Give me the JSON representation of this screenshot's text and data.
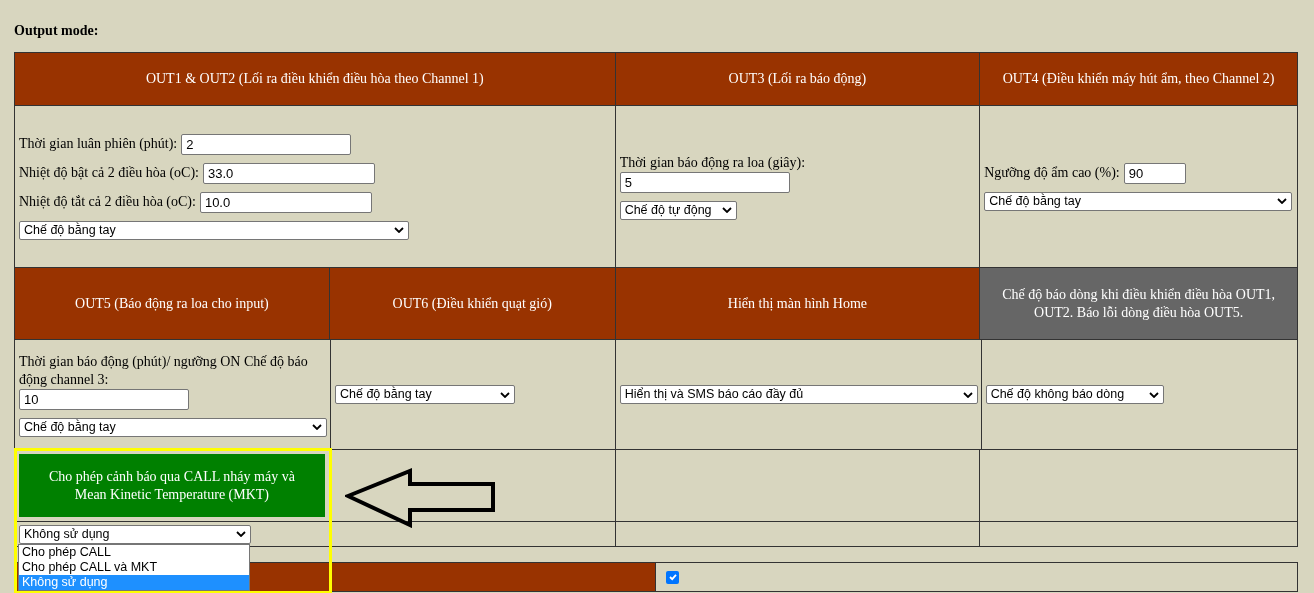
{
  "section_title": "Output mode:",
  "rows": [
    {
      "headers": [
        {
          "title": "OUT1 & OUT2 (Lối ra điều khiển điều hòa theo Channel 1)",
          "color": "#993300"
        },
        {
          "title": "OUT3 (Lối ra báo động)",
          "color": "#993300"
        },
        {
          "title": "OUT4 (Điều khiển máy hút ẩm, theo Channel 2)",
          "color": "#993300"
        }
      ],
      "cells": [
        {
          "controls": [
            {
              "kind": "input",
              "label": "Thời gian luân phiên (phút):",
              "value": "2"
            },
            {
              "kind": "input",
              "label": "Nhiệt độ bật cả 2 điều hòa (oC):",
              "value": "33.0"
            },
            {
              "kind": "input",
              "label": "Nhiệt độ tắt cả 2 điều hòa (oC):",
              "value": "10.0"
            },
            {
              "kind": "select",
              "value": "Chế độ bằng tay"
            }
          ]
        },
        {
          "controls": [
            {
              "kind": "input_below",
              "label": "Thời gian báo động ra loa (giây):",
              "value": "5"
            },
            {
              "kind": "select",
              "value": "Chế độ tự động"
            }
          ]
        },
        {
          "controls": [
            {
              "kind": "input",
              "label": "Ngưỡng độ ẩm cao (%):",
              "value": "90"
            },
            {
              "kind": "select",
              "value": "Chế độ bằng tay"
            }
          ]
        }
      ]
    },
    {
      "headers": [
        {
          "title": "OUT5 (Báo động ra loa cho input)",
          "color": "#993300"
        },
        {
          "title": "OUT6 (Điều khiển quạt gió)",
          "color": "#993300"
        },
        {
          "title": "Hiển thị màn hình Home",
          "color": "#993300"
        },
        {
          "title": "Chế độ báo dòng khi điều khiển điều hòa OUT1, OUT2. Báo lỗi dòng điều hòa OUT5.",
          "color": "#666666"
        }
      ],
      "cells": [
        {
          "controls": [
            {
              "kind": "input_below",
              "label": "Thời gian báo động (phút)/ ngưỡng ON Chế độ báo động channel 3:",
              "value": "10"
            },
            {
              "kind": "select",
              "value": "Chế độ bằng tay"
            }
          ]
        },
        {
          "controls": [
            {
              "kind": "select",
              "value": "Chế độ bằng tay"
            }
          ]
        },
        {
          "controls": [
            {
              "kind": "select",
              "value": "Hiển thị và SMS báo cáo đầy đủ"
            }
          ]
        },
        {
          "controls": [
            {
              "kind": "select",
              "value": "Chế độ không báo dòng"
            }
          ]
        }
      ]
    }
  ],
  "mkt": {
    "title": "Cho phép cảnh báo qua CALL nháy máy và Mean Kinetic Temperature (MKT)",
    "highlighted": true,
    "value": "Không sử dụng",
    "open": true,
    "options": [
      {
        "label": "Cho phép CALL",
        "selected": false
      },
      {
        "label": "Cho phép CALL và MKT",
        "selected": false
      },
      {
        "label": "Không sử dụng",
        "selected": true
      }
    ]
  },
  "bottom": {
    "checked": true
  }
}
